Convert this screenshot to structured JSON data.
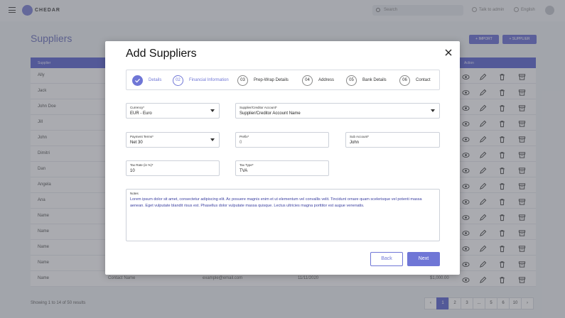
{
  "topbar": {
    "logo_text": "CHEDAR",
    "search_placeholder": "Search",
    "link_inbox": "Talk to admin",
    "link_language": "English"
  },
  "page": {
    "title": "Suppliers",
    "import_label": "IMPORT",
    "add_label": "SUPPLIER"
  },
  "table": {
    "headers": {
      "name": "Supplier",
      "action": "Action"
    },
    "rows": [
      {
        "name": "Ally"
      },
      {
        "name": "Jack"
      },
      {
        "name": "John Doe"
      },
      {
        "name": "Jill"
      },
      {
        "name": "John"
      },
      {
        "name": "Dimitri"
      },
      {
        "name": "Dan"
      },
      {
        "name": "Angela"
      },
      {
        "name": "Ana"
      },
      {
        "name": "Name"
      },
      {
        "name": "Name"
      },
      {
        "name": "Name"
      },
      {
        "name": "Name"
      },
      {
        "name": "Name",
        "contact": "Contact Name",
        "email": "example@email.com",
        "date": "11/11/2020",
        "amount": "$1,000.00"
      }
    ],
    "footer": "Showing 1 to 14 of 50 results",
    "pages": [
      "‹",
      "1",
      "2",
      "3",
      "...",
      "5",
      "6",
      "10",
      "›"
    ],
    "active_page": "1"
  },
  "modal": {
    "title": "Add Suppliers",
    "steps": [
      {
        "num": "✓",
        "label": "Details",
        "state": "done"
      },
      {
        "num": "02",
        "label": "Financial Information",
        "state": "current"
      },
      {
        "num": "03",
        "label": "Prep-Wrap Details",
        "state": "pending"
      },
      {
        "num": "04",
        "label": "Address",
        "state": "pending"
      },
      {
        "num": "05",
        "label": "Bank Details",
        "state": "pending"
      },
      {
        "num": "06",
        "label": "Contact",
        "state": "pending"
      }
    ],
    "currency": {
      "label": "Currency*",
      "value": "EUR - Euro"
    },
    "account": {
      "label": "Supplier/Creditor Account*",
      "value": "Supplier/Creditor Account Name"
    },
    "payment_terms": {
      "label": "Payment Terms*",
      "value": "Net 30"
    },
    "prefix": {
      "label": "Prefix*",
      "value": "0"
    },
    "sub_account": {
      "label": "Sub Account*",
      "value": "John"
    },
    "tax_rate": {
      "label": "Tax Rate (in %)*",
      "value": "10"
    },
    "tax_type": {
      "label": "Tax Type*",
      "value": "TVA"
    },
    "notes": {
      "label": "Notes",
      "value": "Lorem ipsum dolor sit amet, consectetur adipiscing elit. Ac posuere magnis enim et ut elementum vel convallis velit. Tincidunt ornare quam scelerisque vel potenti massa aenean. Eget vulputate blandit risus est. Phasellus dolor vulputate massa quisque. Lectus ultricies magna porttitor est augue venenatis."
    },
    "back_label": "Back",
    "next_label": "Next"
  },
  "colors": {
    "accent": "#6f76d6",
    "title": "#7c82c4"
  }
}
